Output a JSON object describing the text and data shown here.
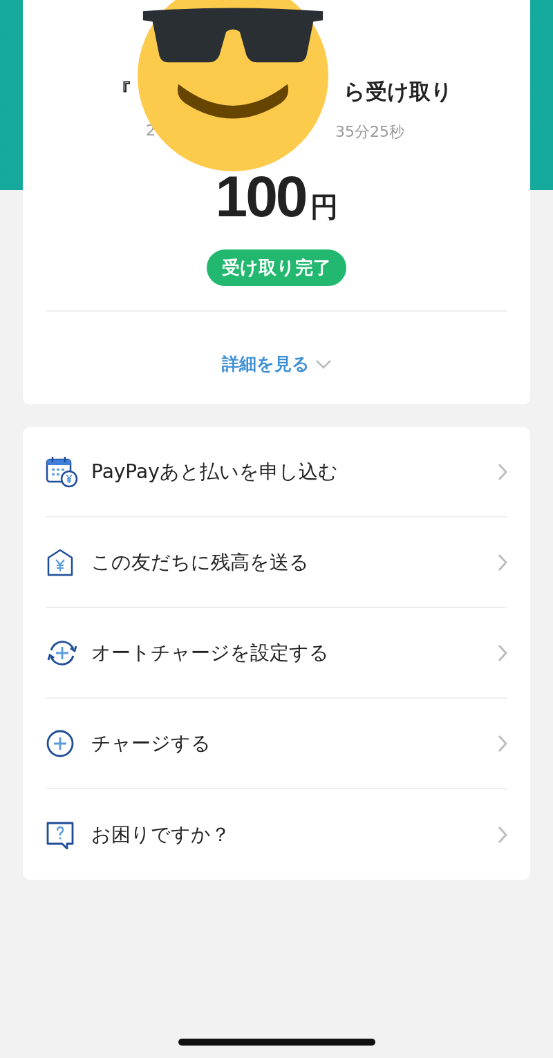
{
  "receipt": {
    "title_start": "『",
    "title_end": "ら受け取り",
    "subtitle_start": "2",
    "subtitle_end": "35分25秒",
    "amount": "100",
    "currency": "円",
    "status": "受け取り完了",
    "details_link": "詳細を見る"
  },
  "menu": [
    {
      "kind": "calendar-yen",
      "label": "PayPayあと払いを申し込む"
    },
    {
      "kind": "house-yen",
      "label": "この友だちに残高を送る"
    },
    {
      "kind": "auto-charge",
      "label": "オートチャージを設定する"
    },
    {
      "kind": "charge",
      "label": "チャージする"
    },
    {
      "kind": "help",
      "label": "お困りですか？"
    }
  ]
}
